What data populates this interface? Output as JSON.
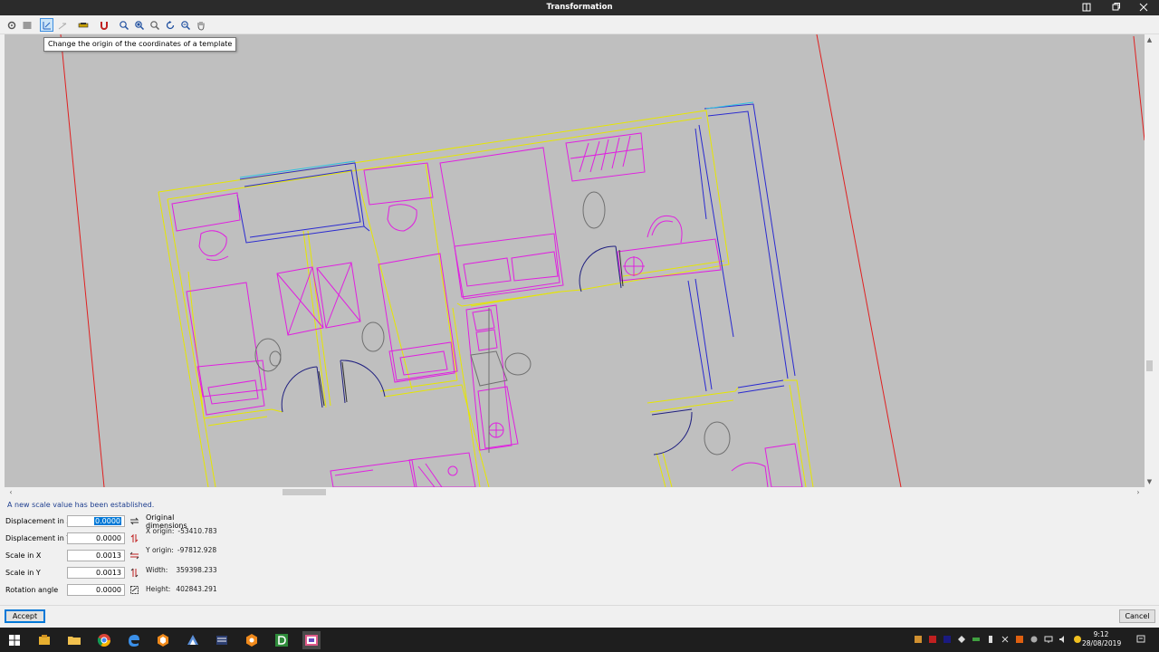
{
  "window": {
    "title": "Transformation"
  },
  "toolbar": {
    "tooltip": "Change the origin of the coordinates of a template"
  },
  "status_message": "A new scale value has been established.",
  "fields": [
    {
      "label": "Displacement in X",
      "value": "0.0000",
      "selected": true,
      "icon": "swap-horizontal-icon"
    },
    {
      "label": "Displacement in Y",
      "value": "0.0000",
      "selected": false,
      "icon": "swap-vertical-icon"
    },
    {
      "label": "Scale in X",
      "value": "0.0013",
      "selected": false,
      "icon": "scale-x-icon"
    },
    {
      "label": "Scale in Y",
      "value": "0.0013",
      "selected": false,
      "icon": "scale-y-icon"
    },
    {
      "label": "Rotation angle",
      "value": "0.0000",
      "selected": false,
      "icon": "rotate-icon"
    }
  ],
  "original_dimensions": {
    "title": "Original dimensions",
    "x_origin_label": "X origin:",
    "x_origin": "-53410.783",
    "y_origin_label": "Y origin:",
    "y_origin": "-97812.928",
    "width_label": "Width:",
    "width": "359398.233",
    "height_label": "Height:",
    "height": "402843.291"
  },
  "buttons": {
    "accept": "Accept",
    "cancel": "Cancel"
  },
  "taskbar": {
    "time": "9:12",
    "date": "28/08/2019"
  },
  "colors": {
    "canvas_bg": "#bfbfbf",
    "wall_yellow": "#e6e600",
    "furniture_magenta": "#e020e0",
    "wall_blue": "#2a2ad0",
    "grid_red": "#e02020",
    "fixture_gray": "#707070"
  }
}
